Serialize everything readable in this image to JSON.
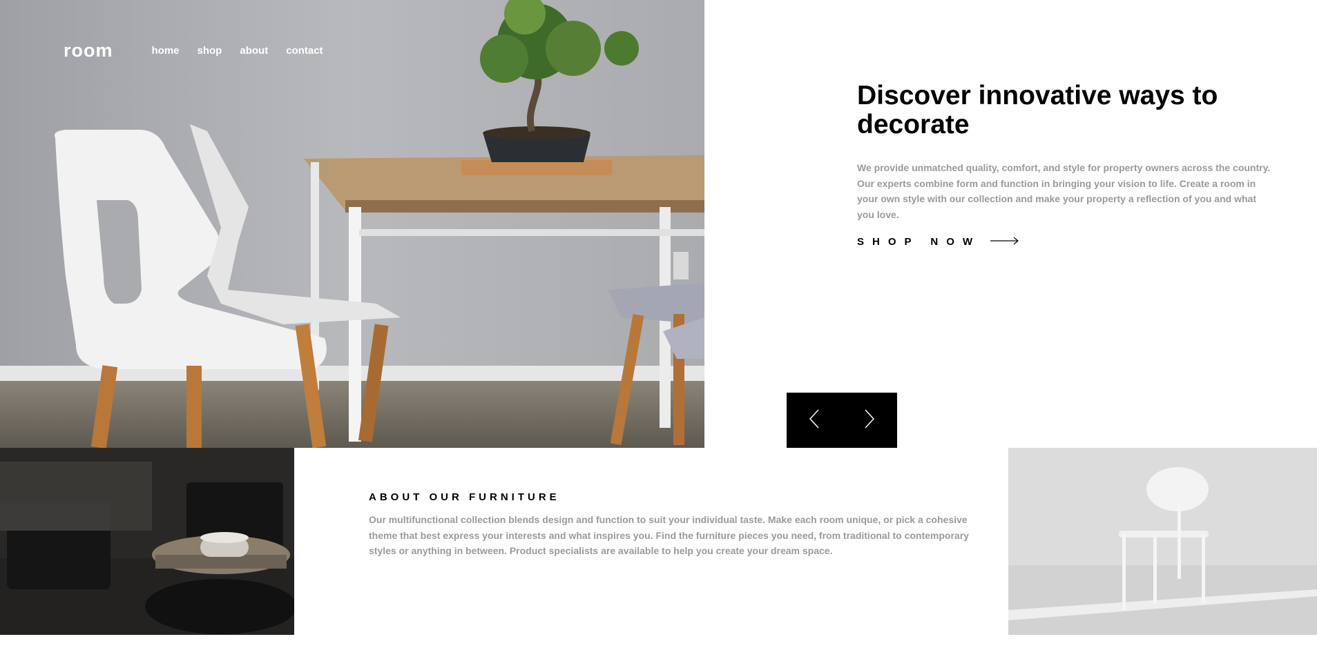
{
  "nav": {
    "logo": "room",
    "links": [
      "home",
      "shop",
      "about",
      "contact"
    ]
  },
  "hero": {
    "title": "Discover innovative ways to decorate",
    "description": "We provide unmatched quality, comfort, and style for property owners across the country. Our experts combine form and function in bringing your vision to life. Create a room in your own style with our collection and make your property a reflection of you and what you love.",
    "cta_label": "SHOP NOW",
    "cta_icon": "arrow-right-icon"
  },
  "slider": {
    "prev_icon": "chevron-left-icon",
    "next_icon": "chevron-right-icon"
  },
  "about": {
    "title": "ABOUT OUR FURNITURE",
    "description": "Our multifunctional collection blends design and function to suit your individual taste. Make each room unique, or pick a cohesive theme that best express your interests and what inspires you. Find the furniture pieces you need, from traditional to contemporary styles or anything in between. Product specialists are available to help you create your dream space."
  },
  "colors": {
    "text_dark": "#000000",
    "text_muted": "#9a9a9a",
    "control_bg": "#000000"
  }
}
